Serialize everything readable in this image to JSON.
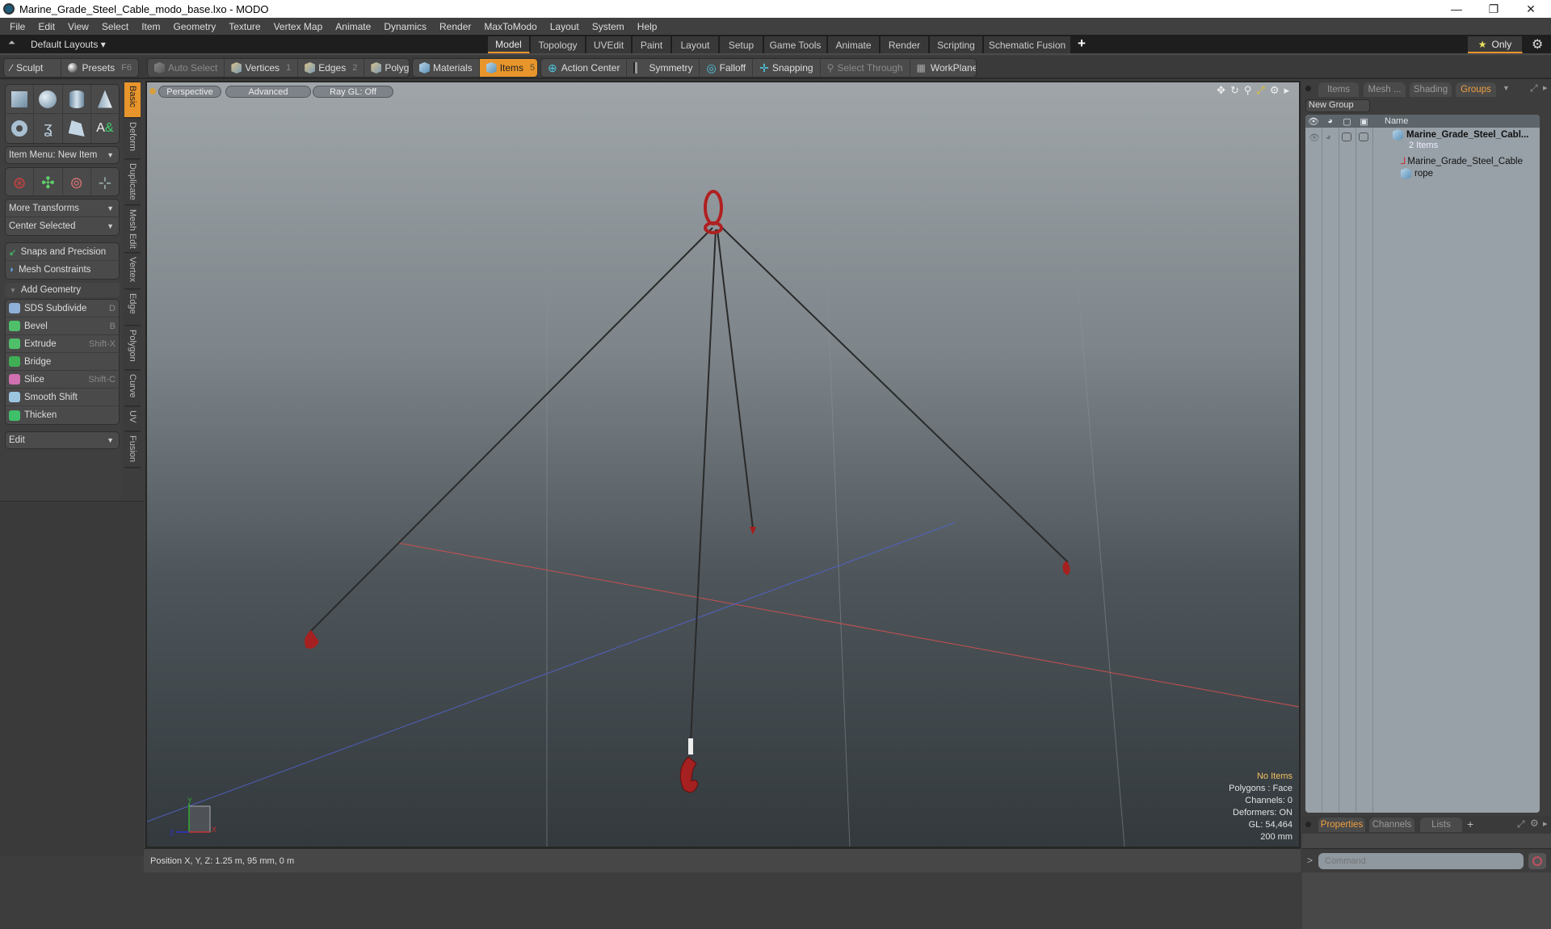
{
  "window": {
    "title": "Marine_Grade_Steel_Cable_modo_base.lxo - MODO",
    "minimize": "—",
    "maximize": "❐",
    "close": "✕"
  },
  "menu": [
    "File",
    "Edit",
    "View",
    "Select",
    "Item",
    "Geometry",
    "Texture",
    "Vertex Map",
    "Animate",
    "Dynamics",
    "Render",
    "MaxToModo",
    "Layout",
    "System",
    "Help"
  ],
  "layouts": {
    "default_label": "Default Layouts ▾",
    "tabs": [
      "Model",
      "Topology",
      "UVEdit",
      "Paint",
      "Layout",
      "Setup",
      "Game Tools",
      "Animate",
      "Render",
      "Scripting",
      "Schematic Fusion"
    ],
    "active_tab": "Model",
    "add_label": "+",
    "only_label": "Only",
    "star_icon": "★",
    "gear_icon": "⚙"
  },
  "toolbar": {
    "sculpt": "Sculpt",
    "presets": "Presets",
    "presets_key": "F6",
    "auto_select": "Auto Select",
    "vertices": "Vertices",
    "vertices_key": "1",
    "edges": "Edges",
    "edges_key": "2",
    "polygons": "Polygons",
    "materials": "Materials",
    "items": "Items",
    "items_key": "5",
    "action_center": "Action Center",
    "symmetry": "Symmetry",
    "falloff": "Falloff",
    "snapping": "Snapping",
    "select_through": "Select Through",
    "workplane": "WorkPlane"
  },
  "left_panel": {
    "item_menu": "Item Menu: New Item",
    "more_transforms": "More Transforms",
    "center_selected": "Center Selected",
    "snaps": "Snaps and Precision",
    "mesh_constraints": "Mesh Constraints",
    "add_geometry": "Add Geometry",
    "tools": [
      {
        "label": "SDS Subdivide",
        "key": "D",
        "color": "#8fb0d8"
      },
      {
        "label": "Bevel",
        "key": "B",
        "color": "#4fbf6a"
      },
      {
        "label": "Extrude",
        "key": "Shift-X",
        "color": "#4fbf6a"
      },
      {
        "label": "Bridge",
        "key": "",
        "color": "#3fae55"
      },
      {
        "label": "Slice",
        "key": "Shift-C",
        "color": "#d070b0"
      },
      {
        "label": "Smooth Shift",
        "key": "",
        "color": "#9cc6e0"
      },
      {
        "label": "Thicken",
        "key": "",
        "color": "#3fbf6a"
      }
    ],
    "edit_dropdown": "Edit",
    "vertical_tabs": [
      "Basic",
      "Deform",
      "Duplicate",
      "Mesh Edit",
      "Vertex",
      "Edge",
      "Polygon",
      "Curve",
      "UV",
      "Fusion"
    ]
  },
  "viewport": {
    "view_mode": "Perspective",
    "shading": "Advanced",
    "raygl": "Ray GL: Off",
    "info": {
      "selection": "No Items",
      "polygons": "Polygons : Face",
      "channels": "Channels: 0",
      "deformers": "Deformers: ON",
      "gl": "GL: 54,464",
      "grid": "200 mm"
    },
    "axis_labels": {
      "x": "X",
      "y": "Y",
      "z": "Z"
    }
  },
  "status": {
    "position": "Position X, Y, Z:   1.25 m, 95 mm, 0 m"
  },
  "right_panel": {
    "tabs": [
      "Items",
      "Mesh ...",
      "Shading",
      "Groups"
    ],
    "active_tab": "Groups",
    "new_group": "New Group",
    "name_header": "Name",
    "group": {
      "name": "Marine_Grade_Steel_Cabl...",
      "count": "2 Items",
      "children": [
        "Marine_Grade_Steel_Cable",
        "rope"
      ]
    },
    "bottom_tabs": [
      "Properties",
      "Channels",
      "Lists"
    ],
    "bottom_active": "Properties",
    "add": "+"
  },
  "command": {
    "prompt": ">",
    "placeholder": "Command"
  }
}
